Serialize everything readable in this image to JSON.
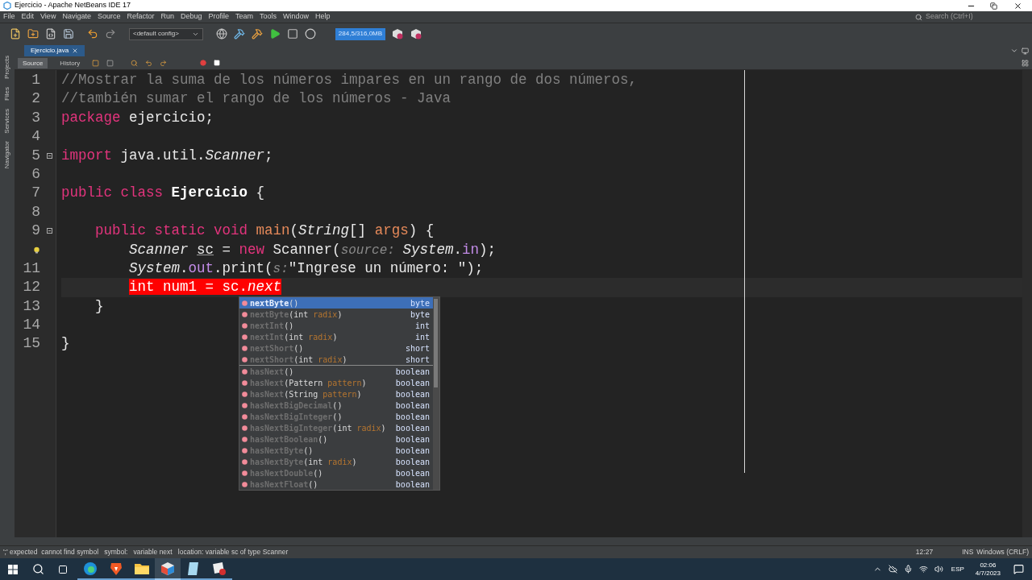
{
  "window": {
    "title": "Ejercicio - Apache NetBeans IDE 17"
  },
  "menu": [
    "File",
    "Edit",
    "View",
    "Navigate",
    "Source",
    "Refactor",
    "Run",
    "Debug",
    "Profile",
    "Team",
    "Tools",
    "Window",
    "Help"
  ],
  "search": {
    "placeholder": "Search (Ctrl+I)"
  },
  "toolbar": {
    "config": "<default config>",
    "memory": "284,5/316,0MB"
  },
  "side_tabs": [
    "Projects",
    "Files",
    "Services",
    "Navigator"
  ],
  "editor_tabs": [
    {
      "label": "Ejercicio.java",
      "selected": true
    }
  ],
  "view_tabs": [
    {
      "label": "Source",
      "selected": true
    },
    {
      "label": "History",
      "selected": false
    }
  ],
  "code": [
    {
      "number": "1",
      "fold": false,
      "tokens": [
        {
          "text": "//Mostrar la suma de los números impares en un rango de dos números,",
          "kind": "comment"
        }
      ]
    },
    {
      "number": "2",
      "fold": false,
      "tokens": [
        {
          "text": "//también sumar el rango de los números - Java",
          "kind": "comment"
        }
      ]
    },
    {
      "number": "3",
      "fold": false,
      "tokens": [
        {
          "text": "package",
          "kind": "keyword"
        },
        {
          "text": " ejercicio;",
          "kind": "plain"
        }
      ]
    },
    {
      "number": "4",
      "fold": false
    },
    {
      "number": "5",
      "fold": true,
      "tokens": [
        {
          "text": "import",
          "kind": "keyword"
        },
        {
          "text": " java.util.",
          "kind": "plain"
        },
        {
          "text": "Scanner",
          "kind": "type"
        },
        {
          "text": ";",
          "kind": "plain"
        }
      ]
    },
    {
      "number": "6",
      "fold": false
    },
    {
      "number": "7",
      "fold": false,
      "tokens": [
        {
          "text": "public class ",
          "kind": "keyword"
        },
        {
          "text": "Ejercicio",
          "kind": "classname"
        },
        {
          "text": " {",
          "kind": "plain"
        }
      ]
    },
    {
      "number": "8",
      "fold": false
    },
    {
      "number": "9",
      "fold": true,
      "tokens": [
        {
          "text": "    public static void ",
          "kind": "keyword"
        },
        {
          "text": "main",
          "kind": "method"
        },
        {
          "text": "(",
          "kind": "plain"
        },
        {
          "text": "String",
          "kind": "type"
        },
        {
          "text": "[] ",
          "kind": "plain"
        },
        {
          "text": "args",
          "kind": "param"
        },
        {
          "text": ") {",
          "kind": "plain"
        }
      ]
    },
    {
      "fold": false,
      "bulb": true,
      "tokens": [
        {
          "text": "        Scanner ",
          "kind": "type"
        },
        {
          "text": "sc",
          "kind": "underlined"
        },
        {
          "text": " = ",
          "kind": "plain"
        },
        {
          "text": "new",
          "kind": "keyword"
        },
        {
          "text": " Scanner(",
          "kind": "plain"
        },
        {
          "text": "source: ",
          "kind": "hint"
        },
        {
          "text": "System",
          "kind": "type"
        },
        {
          "text": ".",
          "kind": "plain"
        },
        {
          "text": "in",
          "kind": "field"
        },
        {
          "text": ");",
          "kind": "plain"
        }
      ]
    },
    {
      "number": "11",
      "fold": false,
      "tokens": [
        {
          "text": "        System",
          "kind": "type"
        },
        {
          "text": ".",
          "kind": "plain"
        },
        {
          "text": "out",
          "kind": "field"
        },
        {
          "text": ".print(",
          "kind": "plain"
        },
        {
          "text": "s:",
          "kind": "hint"
        },
        {
          "text": "\"Ingrese un número: \"",
          "kind": "string"
        },
        {
          "text": ");",
          "kind": "plain"
        }
      ]
    },
    {
      "number": "12",
      "fold": false,
      "current": true,
      "tokens": [
        {
          "text": "        int num1 = sc.",
          "kind": "error"
        },
        {
          "text": "next",
          "kind": "error-italic"
        }
      ]
    },
    {
      "number": "13",
      "fold": false,
      "tokens": [
        {
          "text": "    }",
          "kind": "plain"
        }
      ]
    },
    {
      "number": "14",
      "fold": false
    },
    {
      "number": "15",
      "fold": false,
      "tokens": [
        {
          "text": "}",
          "kind": "plain"
        }
      ]
    }
  ],
  "completion": {
    "groups": [
      {
        "items": [
          {
            "parts": [
              {
                "text": "nextByte",
                "kind": "name"
              },
              {
                "text": "()",
                "kind": "plain"
              }
            ],
            "type": "byte",
            "selected": true
          },
          {
            "parts": [
              {
                "text": "nextByte",
                "kind": "name"
              },
              {
                "text": "(int ",
                "kind": "plain"
              },
              {
                "text": "radix",
                "kind": "param"
              },
              {
                "text": ")",
                "kind": "plain"
              }
            ],
            "type": "byte",
            "selected": false
          },
          {
            "parts": [
              {
                "text": "nextInt",
                "kind": "name"
              },
              {
                "text": "()",
                "kind": "plain"
              }
            ],
            "type": "int",
            "selected": false
          },
          {
            "parts": [
              {
                "text": "nextInt",
                "kind": "name"
              },
              {
                "text": "(int ",
                "kind": "plain"
              },
              {
                "text": "radix",
                "kind": "param"
              },
              {
                "text": ")",
                "kind": "plain"
              }
            ],
            "type": "int",
            "selected": false
          },
          {
            "parts": [
              {
                "text": "nextShort",
                "kind": "name"
              },
              {
                "text": "()",
                "kind": "plain"
              }
            ],
            "type": "short",
            "selected": false
          },
          {
            "parts": [
              {
                "text": "nextShort",
                "kind": "name"
              },
              {
                "text": "(int ",
                "kind": "plain"
              },
              {
                "text": "radix",
                "kind": "param"
              },
              {
                "text": ")",
                "kind": "plain"
              }
            ],
            "type": "short",
            "selected": false
          }
        ]
      },
      {
        "items": [
          {
            "parts": [
              {
                "text": "hasNext",
                "kind": "name"
              },
              {
                "text": "()",
                "kind": "plain"
              }
            ],
            "type": "boolean",
            "selected": false
          },
          {
            "parts": [
              {
                "text": "hasNext",
                "kind": "name"
              },
              {
                "text": "(Pattern ",
                "kind": "plain"
              },
              {
                "text": "pattern",
                "kind": "param"
              },
              {
                "text": ")",
                "kind": "plain"
              }
            ],
            "type": "boolean",
            "selected": false
          },
          {
            "parts": [
              {
                "text": "hasNext",
                "kind": "name"
              },
              {
                "text": "(String ",
                "kind": "plain"
              },
              {
                "text": "pattern",
                "kind": "param"
              },
              {
                "text": ")",
                "kind": "plain"
              }
            ],
            "type": "boolean",
            "selected": false
          },
          {
            "parts": [
              {
                "text": "hasNextBigDecimal",
                "kind": "name"
              },
              {
                "text": "()",
                "kind": "plain"
              }
            ],
            "type": "boolean",
            "selected": false
          },
          {
            "parts": [
              {
                "text": "hasNextBigInteger",
                "kind": "name"
              },
              {
                "text": "()",
                "kind": "plain"
              }
            ],
            "type": "boolean",
            "selected": false
          },
          {
            "parts": [
              {
                "text": "hasNextBigInteger",
                "kind": "name"
              },
              {
                "text": "(int ",
                "kind": "plain"
              },
              {
                "text": "radix",
                "kind": "param"
              },
              {
                "text": ")",
                "kind": "plain"
              }
            ],
            "type": "boolean",
            "selected": false
          },
          {
            "parts": [
              {
                "text": "hasNextBoolean",
                "kind": "name"
              },
              {
                "text": "()",
                "kind": "plain"
              }
            ],
            "type": "boolean",
            "selected": false
          },
          {
            "parts": [
              {
                "text": "hasNextByte",
                "kind": "name"
              },
              {
                "text": "()",
                "kind": "plain"
              }
            ],
            "type": "boolean",
            "selected": false
          },
          {
            "parts": [
              {
                "text": "hasNextByte",
                "kind": "name"
              },
              {
                "text": "(int ",
                "kind": "plain"
              },
              {
                "text": "radix",
                "kind": "param"
              },
              {
                "text": ")",
                "kind": "plain"
              }
            ],
            "type": "boolean",
            "selected": false
          },
          {
            "parts": [
              {
                "text": "hasNextDouble",
                "kind": "name"
              },
              {
                "text": "()",
                "kind": "plain"
              }
            ],
            "type": "boolean",
            "selected": false
          },
          {
            "parts": [
              {
                "text": "hasNextFloat",
                "kind": "name"
              },
              {
                "text": "()",
                "kind": "plain"
              }
            ],
            "type": "boolean",
            "selected": false
          }
        ]
      }
    ]
  },
  "status": {
    "message": "';' expected  cannot find symbol   symbol:   variable next   location: variable sc of type Scanner",
    "position": "12:27",
    "mode": "INS",
    "line_ending": "Windows (CRLF)"
  },
  "taskbar": {
    "apps": [
      {
        "kind": "edge",
        "selected": false
      },
      {
        "kind": "brave",
        "selected": false
      },
      {
        "kind": "folder",
        "selected": false
      },
      {
        "kind": "netbeans",
        "selected": true
      },
      {
        "kind": "notepad",
        "selected": false
      },
      {
        "kind": "photo",
        "selected": false
      }
    ],
    "language": "ESP",
    "time": "02:06",
    "date": "4/7/2023"
  }
}
